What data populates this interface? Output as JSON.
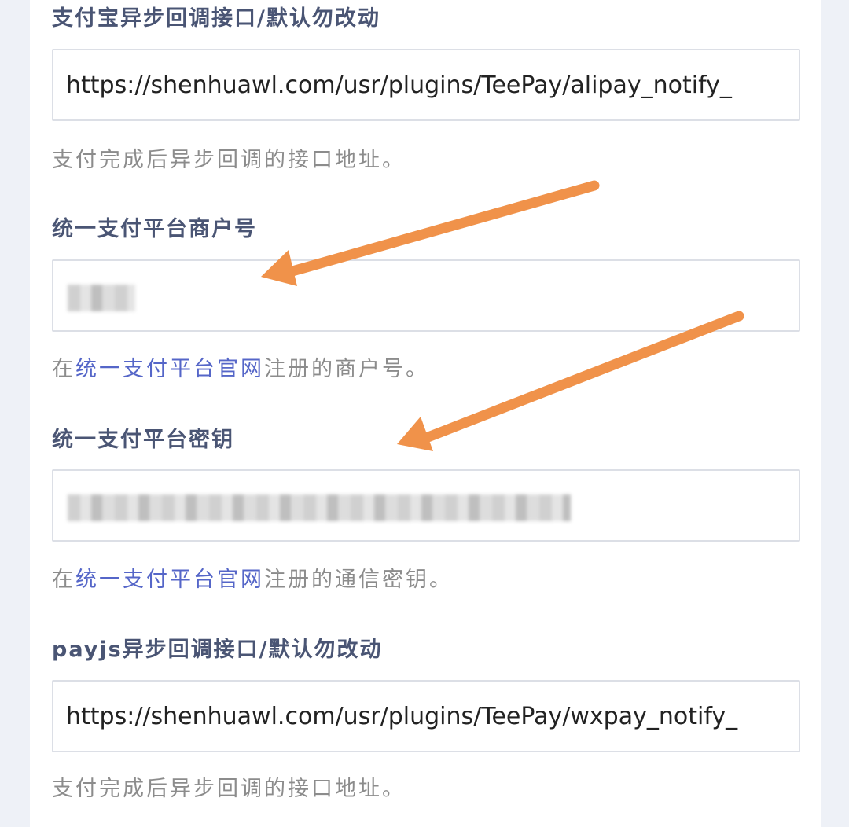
{
  "colors": {
    "background": "#eef1f7",
    "label": "#4a5574",
    "help": "#8c8c8c",
    "link": "#5566c8",
    "arrow": "#f0924a"
  },
  "fields": {
    "alipay_notify": {
      "label": "支付宝异步回调接口/默认勿改动",
      "value": "https://shenhuawl.com/usr/plugins/TeePay/alipay_notify_",
      "help": "支付完成后异步回调的接口地址。"
    },
    "merchant_id": {
      "label": "统一支付平台商户号",
      "help_prefix": "在",
      "help_link": "统一支付平台官网",
      "help_suffix": "注册的商户号。"
    },
    "merchant_key": {
      "label": "统一支付平台密钥",
      "help_prefix": "在",
      "help_link": "统一支付平台官网",
      "help_suffix": "注册的通信密钥。"
    },
    "payjs_notify": {
      "label": "payjs异步回调接口/默认勿改动",
      "value": "https://shenhuawl.com/usr/plugins/TeePay/wxpay_notify_",
      "help": "支付完成后异步回调的接口地址。"
    }
  },
  "annotation_icons": [
    "arrow-icon",
    "arrow-icon"
  ]
}
